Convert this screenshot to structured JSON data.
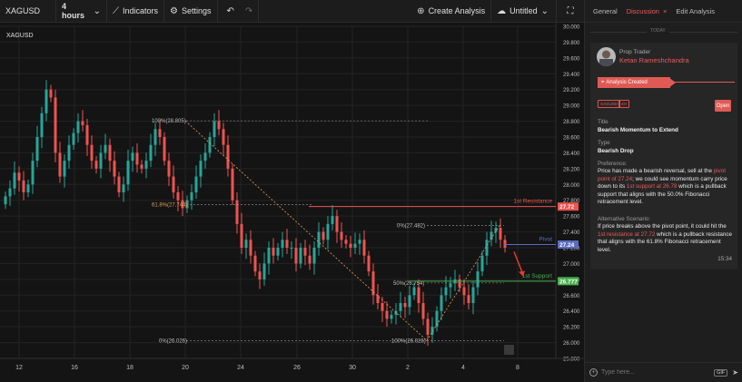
{
  "toolbar": {
    "symbol": "XAGUSD",
    "interval": "4 hours",
    "indicators": "Indicators",
    "settings": "Settings",
    "create_analysis": "Create Analysis",
    "untitled": "Untitled"
  },
  "panel": {
    "tabs": [
      "General",
      "Discussion",
      "Edit Analysis"
    ],
    "today": "TODAY",
    "author_role": "Prop Trader",
    "author_name": "Ketan Rameshchandra",
    "analysis_tag": "Analysis Created",
    "chips": [
      "XAGUSD",
      "4H"
    ],
    "open": "Open",
    "title_label": "Title",
    "title_value": "Bearish Momentum to Extend",
    "type_label": "Type",
    "type_value": "Bearish Drop",
    "preference_label": "Preference:",
    "preference": {
      "p1": "Price has made a bearish reversal, sell at the ",
      "h1": "pivot point of 27.24",
      "p2": "; we could see momentum carry price down to its ",
      "h2": "1st support at 26.78",
      "p3": " which is a pullback support that aligns with the 50.0% Fibonacci retracement level."
    },
    "alt_label": "Alternative Scenario:",
    "alternative": {
      "p1": "If price breaks above the pivot point, it could hit the ",
      "h1": "1st resistance at 27.72",
      "p2": " which is a pullback resistance that aligns with the 61.8% Fibonacci retracement level."
    },
    "time": "15:34",
    "composer_placeholder": "Type here...",
    "gif": "GIF"
  },
  "colors": {
    "up": "#26a69a",
    "down": "#ef5350",
    "resistance": "#ef5350",
    "pivot": "#5c6bc0",
    "support": "#4caf50",
    "fib_up": "#e0a05a",
    "accent": "#e85b5b"
  },
  "chart_data": {
    "type": "candlestick",
    "ylim": [
      25.8,
      30.0
    ],
    "y_ticks": [
      "30.000",
      "29.800",
      "29.600",
      "29.400",
      "29.200",
      "29.000",
      "28.800",
      "28.600",
      "28.400",
      "28.200",
      "28.000",
      "27.800",
      "27.600",
      "27.400",
      "27.200",
      "27.000",
      "26.800",
      "26.600",
      "26.400",
      "26.200",
      "26.000",
      "25.800"
    ],
    "x_ticks": [
      "12",
      "16",
      "18",
      "20",
      "24",
      "26",
      "30",
      "2",
      "4",
      "8"
    ],
    "levels": [
      {
        "name": "1st Resistance",
        "value": 27.72,
        "tag": "27.72"
      },
      {
        "name": "Pivot",
        "value": 27.24,
        "tag": "27.24"
      },
      {
        "name": "1st Support",
        "value": 26.777,
        "tag": "26.777"
      }
    ],
    "fib_labels": [
      {
        "text": "100%(28.805)",
        "value": 28.805
      },
      {
        "text": "61.8%(27.744)",
        "value": 27.744
      },
      {
        "text": "0%(26.026)",
        "value": 26.026
      },
      {
        "text": "0%(27.482)",
        "value": 27.482
      },
      {
        "text": "50%(26.754)",
        "value": 26.754
      },
      {
        "text": "100%(26.026)",
        "value": 26.026
      }
    ],
    "close_path": [
      27.85,
      27.95,
      28.15,
      28.05,
      27.9,
      28.0,
      28.3,
      28.6,
      28.9,
      29.2,
      29.1,
      28.4,
      28.1,
      28.3,
      28.5,
      28.65,
      28.8,
      28.75,
      28.5,
      28.3,
      28.2,
      28.4,
      28.5,
      28.3,
      28.1,
      27.9,
      28.0,
      28.3,
      28.4,
      28.25,
      28.2,
      28.3,
      28.5,
      28.7,
      28.6,
      28.3,
      28.1,
      27.9,
      27.8,
      27.7,
      27.8,
      27.9,
      28.1,
      28.3,
      28.4,
      28.6,
      28.8,
      28.7,
      28.5,
      28.2,
      27.8,
      27.5,
      27.2,
      27.3,
      27.1,
      26.9,
      26.8,
      27.0,
      27.2,
      27.1,
      27.2,
      27.3,
      27.2,
      27.2,
      27.0,
      27.2,
      27.1,
      27.0,
      27.2,
      27.4,
      27.3,
      27.5,
      27.6,
      27.4,
      27.3,
      27.25,
      27.2,
      27.25,
      27.3,
      27.1,
      26.9,
      26.6,
      26.5,
      26.4,
      26.3,
      26.35,
      26.4,
      26.5,
      26.45,
      26.6,
      26.7,
      26.5,
      26.3,
      26.1,
      26.2,
      26.4,
      26.6,
      26.7,
      26.75,
      26.8,
      26.7,
      26.6,
      26.5,
      26.7,
      26.9,
      27.1,
      27.3,
      27.4,
      27.45,
      27.3,
      27.2
    ]
  }
}
